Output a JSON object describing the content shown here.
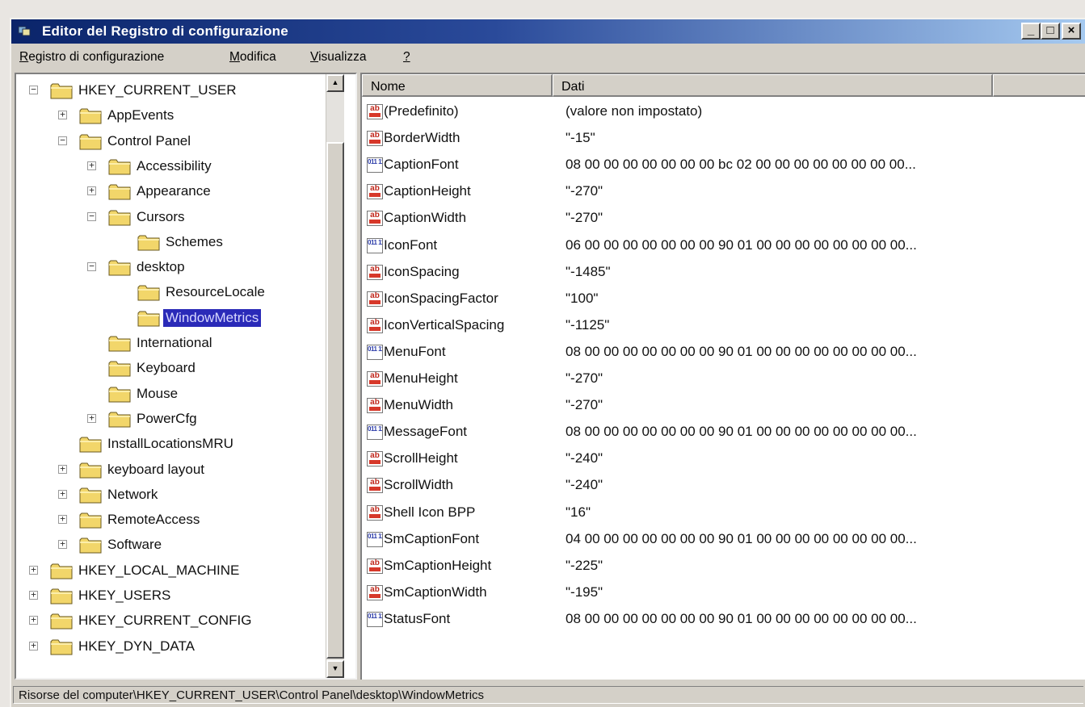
{
  "window": {
    "title": "Editor del Registro di configurazione"
  },
  "title_buttons": {
    "minimize": "_",
    "maximize": "□",
    "close": "×"
  },
  "menu": [
    {
      "accel": "R",
      "rest": "egistro di configurazione"
    },
    {
      "accel": "M",
      "rest": "odifica"
    },
    {
      "accel": "V",
      "rest": "isualizza"
    },
    {
      "accel": "?",
      "rest": ""
    }
  ],
  "tree": {
    "nodes": [
      {
        "label": "HKEY_CURRENT_USER",
        "level": 0,
        "expander": "−"
      },
      {
        "label": "AppEvents",
        "level": 1,
        "expander": "+"
      },
      {
        "label": "Control Panel",
        "level": 1,
        "expander": "−"
      },
      {
        "label": "Accessibility",
        "level": 2,
        "expander": "+"
      },
      {
        "label": "Appearance",
        "level": 2,
        "expander": "+"
      },
      {
        "label": "Cursors",
        "level": 2,
        "expander": "−"
      },
      {
        "label": "Schemes",
        "level": 3,
        "expander": ""
      },
      {
        "label": "desktop",
        "level": 2,
        "expander": "−"
      },
      {
        "label": "ResourceLocale",
        "level": 3,
        "expander": ""
      },
      {
        "label": "WindowMetrics",
        "level": 3,
        "expander": "",
        "selected": true
      },
      {
        "label": "International",
        "level": 2,
        "expander": ""
      },
      {
        "label": "Keyboard",
        "level": 2,
        "expander": ""
      },
      {
        "label": "Mouse",
        "level": 2,
        "expander": ""
      },
      {
        "label": "PowerCfg",
        "level": 2,
        "expander": "+"
      },
      {
        "label": "InstallLocationsMRU",
        "level": 1,
        "expander": ""
      },
      {
        "label": "keyboard layout",
        "level": 1,
        "expander": "+"
      },
      {
        "label": "Network",
        "level": 1,
        "expander": "+"
      },
      {
        "label": "RemoteAccess",
        "level": 1,
        "expander": "+"
      },
      {
        "label": "Software",
        "level": 1,
        "expander": "+"
      },
      {
        "label": "HKEY_LOCAL_MACHINE",
        "level": 0,
        "expander": "+"
      },
      {
        "label": "HKEY_USERS",
        "level": 0,
        "expander": "+"
      },
      {
        "label": "HKEY_CURRENT_CONFIG",
        "level": 0,
        "expander": "+"
      },
      {
        "label": "HKEY_DYN_DATA",
        "level": 0,
        "expander": "+"
      }
    ]
  },
  "list": {
    "columns": [
      "Nome",
      "Dati"
    ],
    "rows": [
      {
        "name": "(Predefinito)",
        "data": "(valore non impostato)",
        "type": "string"
      },
      {
        "name": "BorderWidth",
        "data": "\"-15\"",
        "type": "string"
      },
      {
        "name": "CaptionFont",
        "data": "08 00 00 00 00 00 00 00 bc 02 00 00 00 00 00 00 00 00...",
        "type": "binary"
      },
      {
        "name": "CaptionHeight",
        "data": "\"-270\"",
        "type": "string"
      },
      {
        "name": "CaptionWidth",
        "data": "\"-270\"",
        "type": "string"
      },
      {
        "name": "IconFont",
        "data": "06 00 00 00 00 00 00 00 90 01 00 00 00 00 00 00 00 00...",
        "type": "binary"
      },
      {
        "name": "IconSpacing",
        "data": "\"-1485\"",
        "type": "string"
      },
      {
        "name": "IconSpacingFactor",
        "data": "\"100\"",
        "type": "string"
      },
      {
        "name": "IconVerticalSpacing",
        "data": "\"-1125\"",
        "type": "string"
      },
      {
        "name": "MenuFont",
        "data": "08 00 00 00 00 00 00 00 90 01 00 00 00 00 00 00 00 00...",
        "type": "binary"
      },
      {
        "name": "MenuHeight",
        "data": "\"-270\"",
        "type": "string"
      },
      {
        "name": "MenuWidth",
        "data": "\"-270\"",
        "type": "string"
      },
      {
        "name": "MessageFont",
        "data": "08 00 00 00 00 00 00 00 90 01 00 00 00 00 00 00 00 00...",
        "type": "binary"
      },
      {
        "name": "ScrollHeight",
        "data": "\"-240\"",
        "type": "string"
      },
      {
        "name": "ScrollWidth",
        "data": "\"-240\"",
        "type": "string"
      },
      {
        "name": "Shell Icon BPP",
        "data": "\"16\"",
        "type": "string"
      },
      {
        "name": "SmCaptionFont",
        "data": "04 00 00 00 00 00 00 00 90 01 00 00 00 00 00 00 00 00...",
        "type": "binary"
      },
      {
        "name": "SmCaptionHeight",
        "data": "\"-225\"",
        "type": "string"
      },
      {
        "name": "SmCaptionWidth",
        "data": "\"-195\"",
        "type": "string"
      },
      {
        "name": "StatusFont",
        "data": "08 00 00 00 00 00 00 00 90 01 00 00 00 00 00 00 00 00...",
        "type": "binary"
      }
    ]
  },
  "statusbar": {
    "path": "Risorse del computer\\HKEY_CURRENT_USER\\Control Panel\\desktop\\WindowMetrics"
  },
  "icons": {
    "app": "regedit-icon",
    "folder": "folder-icon",
    "string_value": "string-value-icon",
    "binary_value": "binary-value-icon"
  },
  "colors": {
    "titlebar_start": "#0a246a",
    "titlebar_end": "#a6caf0",
    "selection": "#2a2ab8",
    "folder": "#f2d66a"
  }
}
